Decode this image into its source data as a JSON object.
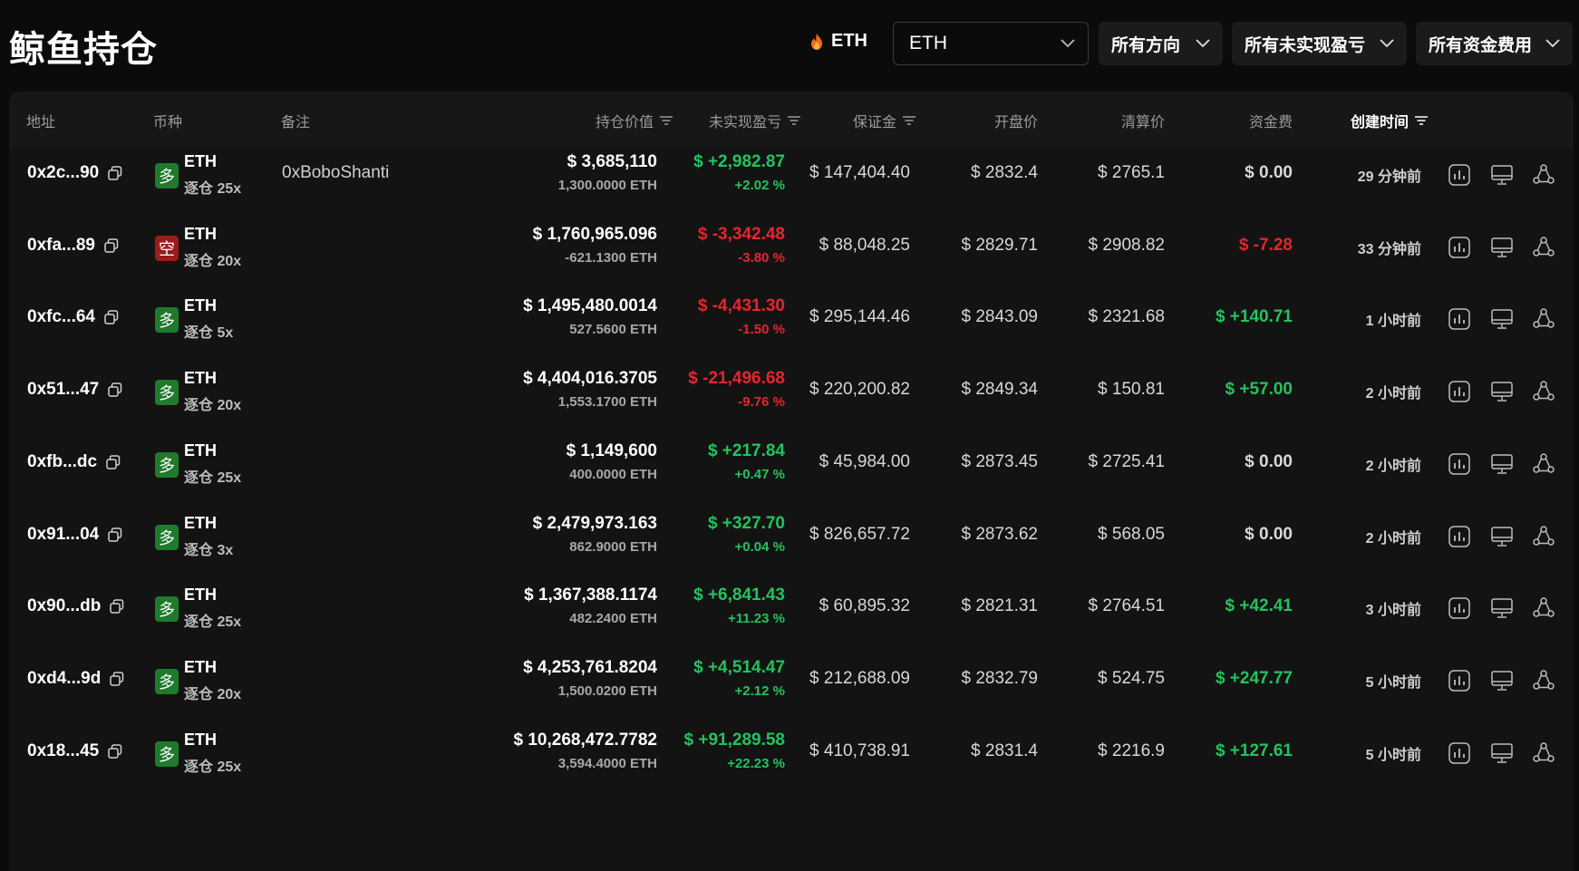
{
  "header": {
    "title": "鲸鱼持仓",
    "coin_tag": "ETH",
    "coin_select": "ETH",
    "direction_select": "所有方向",
    "pnl_select": "所有未实现盈亏",
    "funding_select": "所有资金费用"
  },
  "table": {
    "columns": {
      "address": "地址",
      "coin": "币种",
      "note": "备注",
      "value": "持仓价值",
      "pnl": "未实现盈亏",
      "margin": "保证金",
      "entry": "开盘价",
      "liq": "清算价",
      "funding": "资金费",
      "created": "创建时间"
    },
    "rows": [
      {
        "address": "0x2c...90",
        "side": "多",
        "side_type": "long",
        "symbol": "ETH",
        "leverage": "逐仓 25x",
        "note": "0xBoboShanti",
        "value": "$ 3,685,110",
        "qty": "1,300.0000 ETH",
        "pnl": "$ +2,982.87",
        "pnl_pct": "+2.02 %",
        "pnl_sign": "pos",
        "margin": "$ 147,404.40",
        "entry": "$ 2832.4",
        "liq": "$ 2765.1",
        "funding": "$ 0.00",
        "funding_sign": "neutral",
        "created": "29 分钟前"
      },
      {
        "address": "0xfa...89",
        "side": "空",
        "side_type": "short",
        "symbol": "ETH",
        "leverage": "逐仓 20x",
        "note": "",
        "value": "$ 1,760,965.096",
        "qty": "-621.1300 ETH",
        "pnl": "$ -3,342.48",
        "pnl_pct": "-3.80 %",
        "pnl_sign": "neg",
        "margin": "$ 88,048.25",
        "entry": "$ 2829.71",
        "liq": "$ 2908.82",
        "funding": "$ -7.28",
        "funding_sign": "neg",
        "created": "33 分钟前"
      },
      {
        "address": "0xfc...64",
        "side": "多",
        "side_type": "long",
        "symbol": "ETH",
        "leverage": "逐仓 5x",
        "note": "",
        "value": "$ 1,495,480.0014",
        "qty": "527.5600 ETH",
        "pnl": "$ -4,431.30",
        "pnl_pct": "-1.50 %",
        "pnl_sign": "neg",
        "margin": "$ 295,144.46",
        "entry": "$ 2843.09",
        "liq": "$ 2321.68",
        "funding": "$ +140.71",
        "funding_sign": "pos",
        "created": "1 小时前"
      },
      {
        "address": "0x51...47",
        "side": "多",
        "side_type": "long",
        "symbol": "ETH",
        "leverage": "逐仓 20x",
        "note": "",
        "value": "$ 4,404,016.3705",
        "qty": "1,553.1700 ETH",
        "pnl": "$ -21,496.68",
        "pnl_pct": "-9.76 %",
        "pnl_sign": "neg",
        "margin": "$ 220,200.82",
        "entry": "$ 2849.34",
        "liq": "$ 150.81",
        "funding": "$ +57.00",
        "funding_sign": "pos",
        "created": "2 小时前"
      },
      {
        "address": "0xfb...dc",
        "side": "多",
        "side_type": "long",
        "symbol": "ETH",
        "leverage": "逐仓 25x",
        "note": "",
        "value": "$ 1,149,600",
        "qty": "400.0000 ETH",
        "pnl": "$ +217.84",
        "pnl_pct": "+0.47 %",
        "pnl_sign": "pos",
        "margin": "$ 45,984.00",
        "entry": "$ 2873.45",
        "liq": "$ 2725.41",
        "funding": "$ 0.00",
        "funding_sign": "neutral",
        "created": "2 小时前"
      },
      {
        "address": "0x91...04",
        "side": "多",
        "side_type": "long",
        "symbol": "ETH",
        "leverage": "逐仓 3x",
        "note": "",
        "value": "$ 2,479,973.163",
        "qty": "862.9000 ETH",
        "pnl": "$ +327.70",
        "pnl_pct": "+0.04 %",
        "pnl_sign": "pos",
        "margin": "$ 826,657.72",
        "entry": "$ 2873.62",
        "liq": "$ 568.05",
        "funding": "$ 0.00",
        "funding_sign": "neutral",
        "created": "2 小时前"
      },
      {
        "address": "0x90...db",
        "side": "多",
        "side_type": "long",
        "symbol": "ETH",
        "leverage": "逐仓 25x",
        "note": "",
        "value": "$ 1,367,388.1174",
        "qty": "482.2400 ETH",
        "pnl": "$ +6,841.43",
        "pnl_pct": "+11.23 %",
        "pnl_sign": "pos",
        "margin": "$ 60,895.32",
        "entry": "$ 2821.31",
        "liq": "$ 2764.51",
        "funding": "$ +42.41",
        "funding_sign": "pos",
        "created": "3 小时前"
      },
      {
        "address": "0xd4...9d",
        "side": "多",
        "side_type": "long",
        "symbol": "ETH",
        "leverage": "逐仓 20x",
        "note": "",
        "value": "$ 4,253,761.8204",
        "qty": "1,500.0200 ETH",
        "pnl": "$ +4,514.47",
        "pnl_pct": "+2.12 %",
        "pnl_sign": "pos",
        "margin": "$ 212,688.09",
        "entry": "$ 2832.79",
        "liq": "$ 524.75",
        "funding": "$ +247.77",
        "funding_sign": "pos",
        "created": "5 小时前"
      },
      {
        "address": "0x18...45",
        "side": "多",
        "side_type": "long",
        "symbol": "ETH",
        "leverage": "逐仓 25x",
        "note": "",
        "value": "$ 10,268,472.7782",
        "qty": "3,594.4000 ETH",
        "pnl": "$ +91,289.58",
        "pnl_pct": "+22.23 %",
        "pnl_sign": "pos",
        "margin": "$ 410,738.91",
        "entry": "$ 2831.4",
        "liq": "$ 2216.9",
        "funding": "$ +127.61",
        "funding_sign": "pos",
        "created": "5 小时前"
      }
    ]
  },
  "colors": {
    "positive": "#22c35e",
    "negative": "#e5252e",
    "long_badge": "#1f7a2c",
    "short_badge": "#9c1b1b"
  },
  "icons": {
    "fire": "fire-icon",
    "chevron": "chevron-down-icon",
    "filter": "filter-icon",
    "copy": "copy-icon",
    "chart": "bar-chart-icon",
    "monitor": "monitor-icon",
    "share": "share-icon"
  }
}
